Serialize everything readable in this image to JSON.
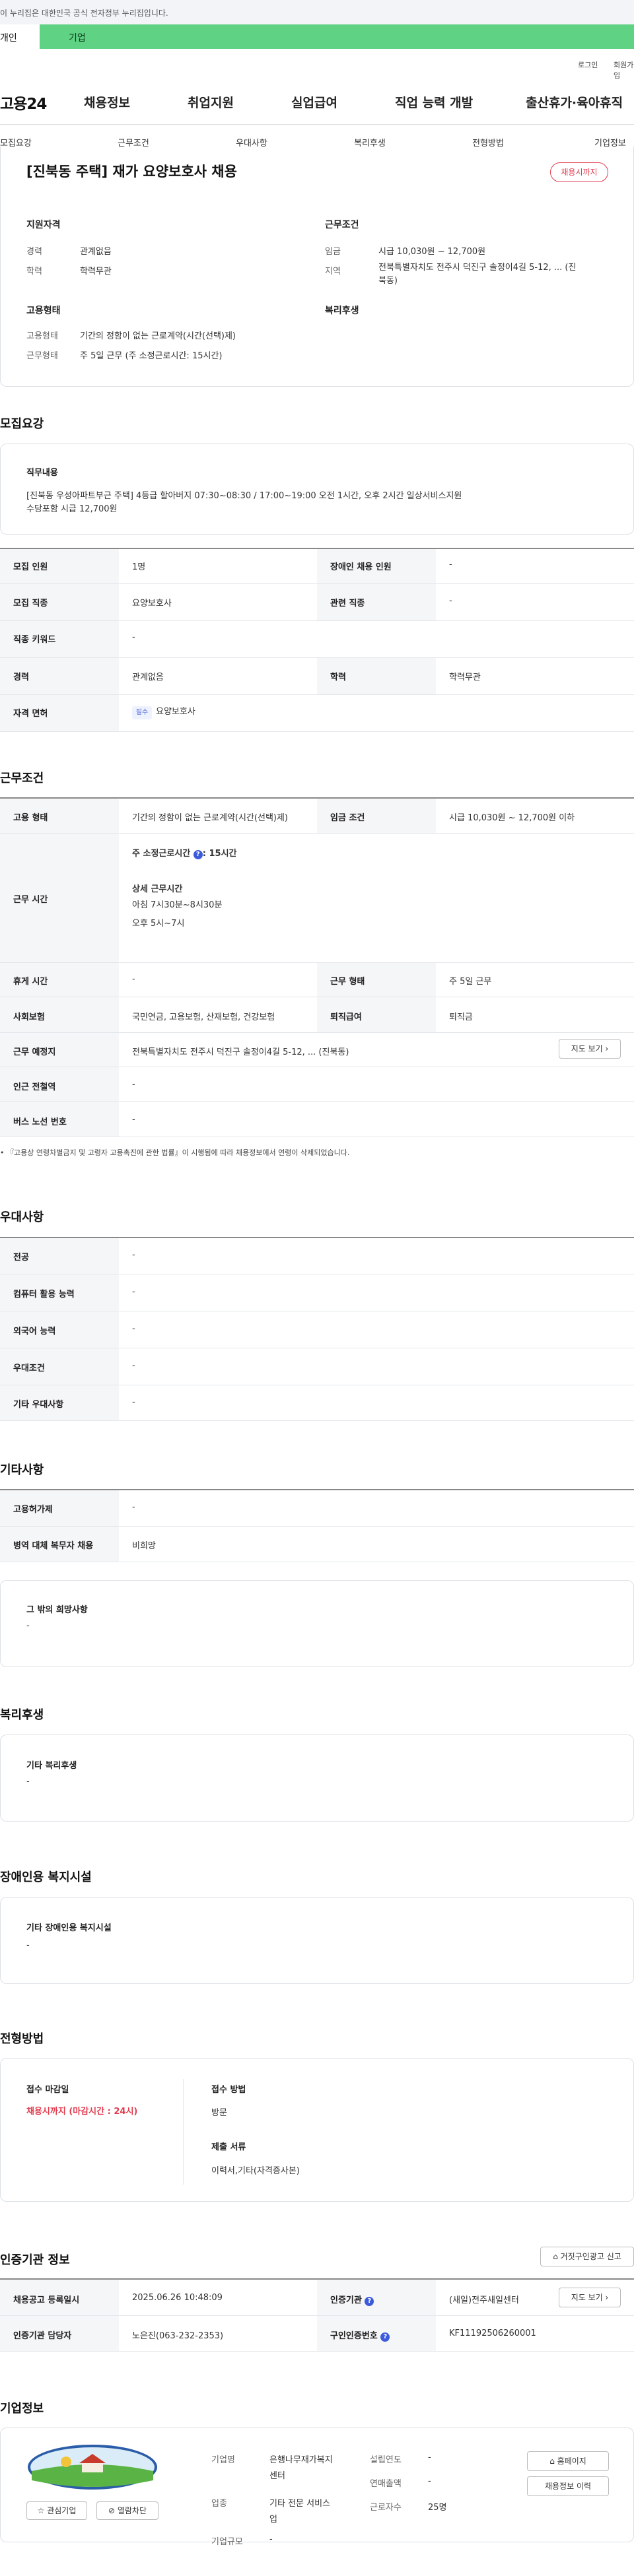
{
  "gov_banner": "이 누리집은 대한민국 공식 전자정부 누리집입니다.",
  "tabs": {
    "person": "개인",
    "company": "기업"
  },
  "util": {
    "login": "로그인",
    "join": "회원가입"
  },
  "header": {
    "logo": "고용24",
    "gnb": [
      "채용정보",
      "취업지원",
      "실업급여",
      "직업 능력 개발",
      "출산휴가·육아휴직"
    ]
  },
  "anchors": [
    "모집요강",
    "근무조건",
    "우대사항",
    "복리후생",
    "전형방법",
    "기업정보"
  ],
  "summary": {
    "title": "[진북동 주택] 재가 요양보호사 채용",
    "badge": "채용시까지",
    "qual_title": "지원자격",
    "career_label": "경력",
    "career_value": "관계없음",
    "edu_label": "학력",
    "edu_value": "학력무관",
    "cond_title": "근무조건",
    "wage_label": "임금",
    "wage_value": "시급 10,030원 ~ 12,700원",
    "region_label": "지역",
    "region_value_1": "전북특별자치도 전주시 덕진구 솔정이4길 5-12, ... (진",
    "region_value_2": "북동)",
    "emp_title": "고용형태",
    "emptype_label": "고용형태",
    "emptype_value": "기간의 정함이 없는 근로계약(시간(선택)제)",
    "workform_label": "근무형태",
    "workform_value": "주 5일 근무 (주 소정근로시간: 15시간)",
    "welfare_title": "복리후생"
  },
  "recruit": {
    "section_title": "모집요강",
    "job_title": "직무내용",
    "job_line1": "[진북동 우성아파트부근 주택] 4등급 할아버지  07:30~08:30 / 17:00~19:00 오전 1시간, 오후 2시간  일상서비스지원",
    "job_line2": "수당포함 시급 12,700원",
    "rows": {
      "headcount_label": "모집 인원",
      "headcount_value": "1명",
      "disabled_label": "장애인 채용 인원",
      "disabled_value": "-",
      "job_label": "모집 직종",
      "job_value": "요양보호사",
      "related_label": "관련 직종",
      "related_value": "-",
      "keyword_label": "직종 키워드",
      "keyword_value": "-",
      "career_label": "경력",
      "career_value": "관계없음",
      "edu_label": "학력",
      "edu_value": "학력무관",
      "license_label": "자격 면허",
      "license_tag": "필수",
      "license_value": "요양보호사"
    }
  },
  "work": {
    "section_title": "근무조건",
    "emptype_label": "고용 형태",
    "emptype_value": "기간의 정함이 없는 근로계약(시간(선택)제)",
    "wage_label": "임금 조건",
    "wage_value": "시급 10,030원 ~ 12,700원 이하",
    "hours_label": "근무 시간",
    "weekly_hours": "주 소정근로시간",
    "weekly_hours_value": ": 15시간",
    "detail_title": "상세 근무시간",
    "detail_line1": "아침 7시30분~8시30분",
    "detail_line2": "오후 5시~7시",
    "rest_label": "휴게 시간",
    "rest_value": "-",
    "workform_label": "근무 형태",
    "workform_value": "주 5일 근무",
    "insurance_label": "사회보험",
    "insurance_value": "국민연금, 고용보험, 산재보험, 건강보험",
    "severance_label": "퇴직급여",
    "severance_value": "퇴직금",
    "location_label": "근무 예정지",
    "location_value": "전북특별자치도 전주시 덕진구 솔정이4길 5-12, ... (진북동)",
    "map_button": "지도 보기",
    "subway_label": "인근 전철역",
    "subway_value": "-",
    "bus_label": "버스 노선 번호",
    "bus_value": "-",
    "note": "『고용상 연령차별금지 및 고령자 고용촉진에 관한 법률』이 시행됨에 따라 채용정보에서 연령이 삭제되었습니다."
  },
  "prefer": {
    "section_title": "우대사항",
    "rows": [
      {
        "label": "전공",
        "value": "-"
      },
      {
        "label": "컴퓨터 활용 능력",
        "value": "-"
      },
      {
        "label": "외국어 능력",
        "value": "-"
      },
      {
        "label": "우대조건",
        "value": "-"
      },
      {
        "label": "기타 우대사항",
        "value": "-"
      }
    ]
  },
  "etc": {
    "section_title": "기타사항",
    "rows": [
      {
        "label": "고용허가제",
        "value": "-"
      },
      {
        "label": "병역 대체 복무자 채용",
        "value": "비희망"
      }
    ],
    "box_title": "그 밖의 희망사항",
    "box_value": "-"
  },
  "benefit": {
    "section_title": "복리후생",
    "box_title": "기타 복리후생",
    "box_value": "-"
  },
  "disability": {
    "section_title": "장애인용 복지시설",
    "box_title": "기타 장애인용 복지시설",
    "box_value": "-"
  },
  "selection": {
    "section_title": "전형방법",
    "deadline_title": "접수 마감일",
    "deadline_value": "채용시까지 (마감시간 : 24시)",
    "method_title": "접수 방법",
    "method_value": "방문",
    "docs_title": "제출 서류",
    "docs_value": "이력서,기타(자격증사본)"
  },
  "certification": {
    "section_title": "인증기관 정보",
    "report_button": "거짓구인광고 신고",
    "reg_date_label": "채용공고 등록일시",
    "reg_date_value": "2025.06.26 10:48:09",
    "agency_label": "인증기관",
    "agency_value": "(새일)전주새일센터",
    "map_button": "지도 보기",
    "manager_label": "인증기관 담당자",
    "manager_value": "노은진(063-232-2353)",
    "number_label": "구인인증번호",
    "number_value": "KF11192506260001"
  },
  "company": {
    "section_title": "기업정보",
    "fav_button": "관심기업",
    "block_button": "열람차단",
    "name_label": "기업명",
    "name_value_1": "은행나무재가복지",
    "name_value_2": "센터",
    "industry_label": "업종",
    "industry_value_1": "기타 전문 서비스",
    "industry_value_2": "업",
    "size_label": "기업규모",
    "size_value": "-",
    "founded_label": "설립연도",
    "founded_value": "-",
    "sales_label": "연매출액",
    "sales_value": "-",
    "employees_label": "근로자수",
    "employees_value": "25명",
    "homepage_button": "홈페이지",
    "history_button": "채용정보 이력"
  }
}
